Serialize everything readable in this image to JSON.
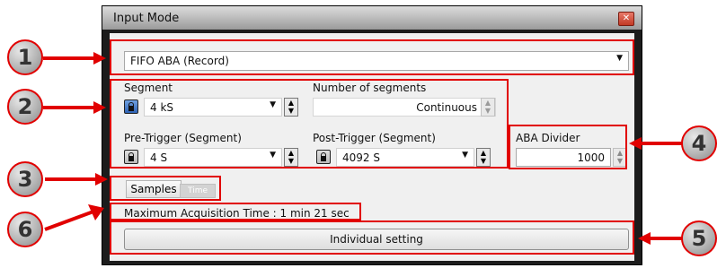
{
  "window": {
    "title": "Input Mode",
    "close_icon": "close-icon"
  },
  "mode_select": {
    "value": "FIFO ABA (Record)"
  },
  "segment": {
    "label": "Segment",
    "value": "4 kS"
  },
  "num_segments": {
    "label": "Number of segments",
    "value": "Continuous"
  },
  "pre_trigger": {
    "label": "Pre-Trigger (Segment)",
    "value": "4 S"
  },
  "post_trigger": {
    "label": "Post-Trigger (Segment)",
    "value": "4092 S"
  },
  "aba_divider": {
    "label": "ABA Divider",
    "value": "1000"
  },
  "units_toggle": {
    "samples": "Samples",
    "time": "Time"
  },
  "acquisition": {
    "text": "Maximum Acquisition Time : 1 min 21 sec"
  },
  "individual_button": {
    "label": "Individual setting"
  },
  "callouts": [
    "1",
    "2",
    "3",
    "4",
    "5",
    "6"
  ],
  "colors": {
    "annotation": "#e10000",
    "window_frame": "#1c1c1c",
    "panel": "#f0f0f0"
  }
}
